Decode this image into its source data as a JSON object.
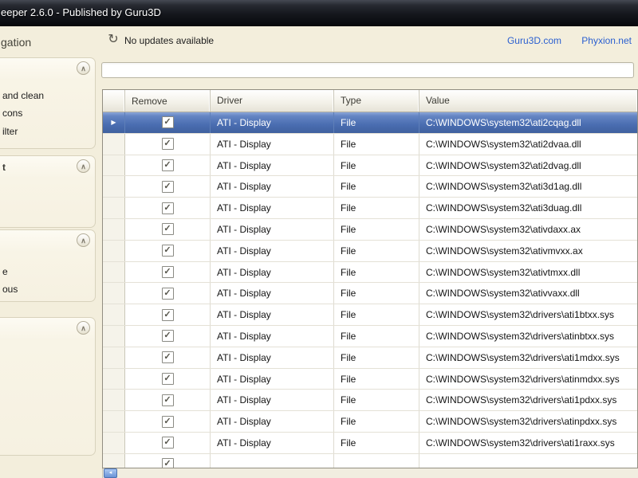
{
  "titlebar": {
    "title": "eeper 2.6.0 - Published by Guru3D"
  },
  "toolbar": {
    "status": "No updates available",
    "refresh_glyph": "↻",
    "links": [
      "Guru3D.com",
      "Phyxion.net"
    ]
  },
  "colors": {
    "link": "#2a5fd0",
    "selection_top": "#8aa5d8",
    "selection_bottom": "#40619f",
    "toolbar_bg": "#f3eedc"
  },
  "sidebar": {
    "header": "gation",
    "chevron_glyph": "∧",
    "panels": [
      {
        "title": "",
        "items": [
          "and clean",
          "cons",
          "ilter"
        ]
      },
      {
        "title": "t",
        "items": []
      },
      {
        "title": "",
        "items": [
          "e",
          "ous"
        ]
      },
      {
        "title": "",
        "items": []
      }
    ]
  },
  "grid": {
    "columns": [
      "Remove",
      "Driver",
      "Type",
      "Value"
    ],
    "selected_row_index": 0,
    "selected_arrow_glyph": "▶",
    "check_glyph": "✓",
    "rows": [
      {
        "checked": true,
        "driver": "ATI - Display",
        "type": "File",
        "value": "C:\\WINDOWS\\system32\\ati2cqag.dll"
      },
      {
        "checked": true,
        "driver": "ATI - Display",
        "type": "File",
        "value": "C:\\WINDOWS\\system32\\ati2dvaa.dll"
      },
      {
        "checked": true,
        "driver": "ATI - Display",
        "type": "File",
        "value": "C:\\WINDOWS\\system32\\ati2dvag.dll"
      },
      {
        "checked": true,
        "driver": "ATI - Display",
        "type": "File",
        "value": "C:\\WINDOWS\\system32\\ati3d1ag.dll"
      },
      {
        "checked": true,
        "driver": "ATI - Display",
        "type": "File",
        "value": "C:\\WINDOWS\\system32\\ati3duag.dll"
      },
      {
        "checked": true,
        "driver": "ATI - Display",
        "type": "File",
        "value": "C:\\WINDOWS\\system32\\ativdaxx.ax"
      },
      {
        "checked": true,
        "driver": "ATI - Display",
        "type": "File",
        "value": "C:\\WINDOWS\\system32\\ativmvxx.ax"
      },
      {
        "checked": true,
        "driver": "ATI - Display",
        "type": "File",
        "value": "C:\\WINDOWS\\system32\\ativtmxx.dll"
      },
      {
        "checked": true,
        "driver": "ATI - Display",
        "type": "File",
        "value": "C:\\WINDOWS\\system32\\ativvaxx.dll"
      },
      {
        "checked": true,
        "driver": "ATI - Display",
        "type": "File",
        "value": "C:\\WINDOWS\\system32\\drivers\\ati1btxx.sys"
      },
      {
        "checked": true,
        "driver": "ATI - Display",
        "type": "File",
        "value": "C:\\WINDOWS\\system32\\drivers\\atinbtxx.sys"
      },
      {
        "checked": true,
        "driver": "ATI - Display",
        "type": "File",
        "value": "C:\\WINDOWS\\system32\\drivers\\ati1mdxx.sys"
      },
      {
        "checked": true,
        "driver": "ATI - Display",
        "type": "File",
        "value": "C:\\WINDOWS\\system32\\drivers\\atinmdxx.sys"
      },
      {
        "checked": true,
        "driver": "ATI - Display",
        "type": "File",
        "value": "C:\\WINDOWS\\system32\\drivers\\ati1pdxx.sys"
      },
      {
        "checked": true,
        "driver": "ATI - Display",
        "type": "File",
        "value": "C:\\WINDOWS\\system32\\drivers\\atinpdxx.sys"
      },
      {
        "checked": true,
        "driver": "ATI - Display",
        "type": "File",
        "value": "C:\\WINDOWS\\system32\\drivers\\ati1raxx.sys"
      },
      {
        "checked": true,
        "driver": "",
        "type": "",
        "value": ""
      }
    ]
  }
}
